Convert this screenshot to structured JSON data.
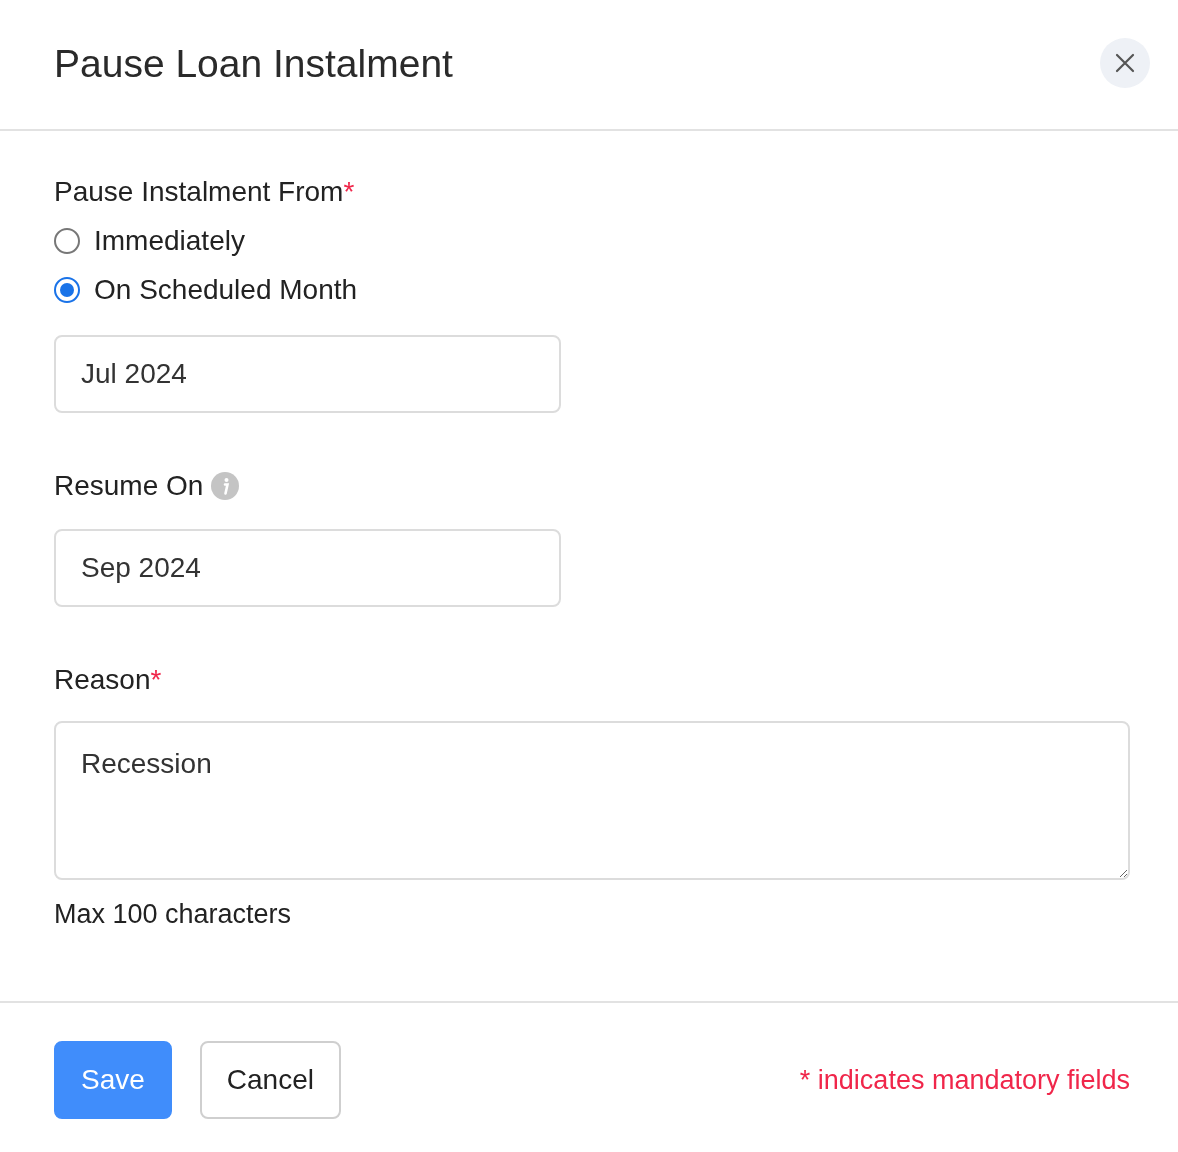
{
  "dialog": {
    "title": "Pause Loan Instalment"
  },
  "fields": [
    {
      "kind": "radio_group",
      "label": "Pause Instalment From",
      "required_mark": "*",
      "options": [
        {
          "label": "Immediately",
          "selected": false
        },
        {
          "label": "On Scheduled Month",
          "selected": true
        }
      ],
      "value": "Jul 2024"
    },
    {
      "kind": "month",
      "label": "Resume On",
      "info": true,
      "value": "Sep 2024"
    },
    {
      "kind": "textarea",
      "label": "Reason",
      "required_mark": "*",
      "value": "Recession",
      "hint": "Max 100 characters"
    }
  ],
  "footer": {
    "buttons": [
      {
        "label": "Save",
        "kind": "primary"
      },
      {
        "label": "Cancel",
        "kind": "secondary"
      }
    ],
    "note": "* indicates mandatory fields"
  }
}
